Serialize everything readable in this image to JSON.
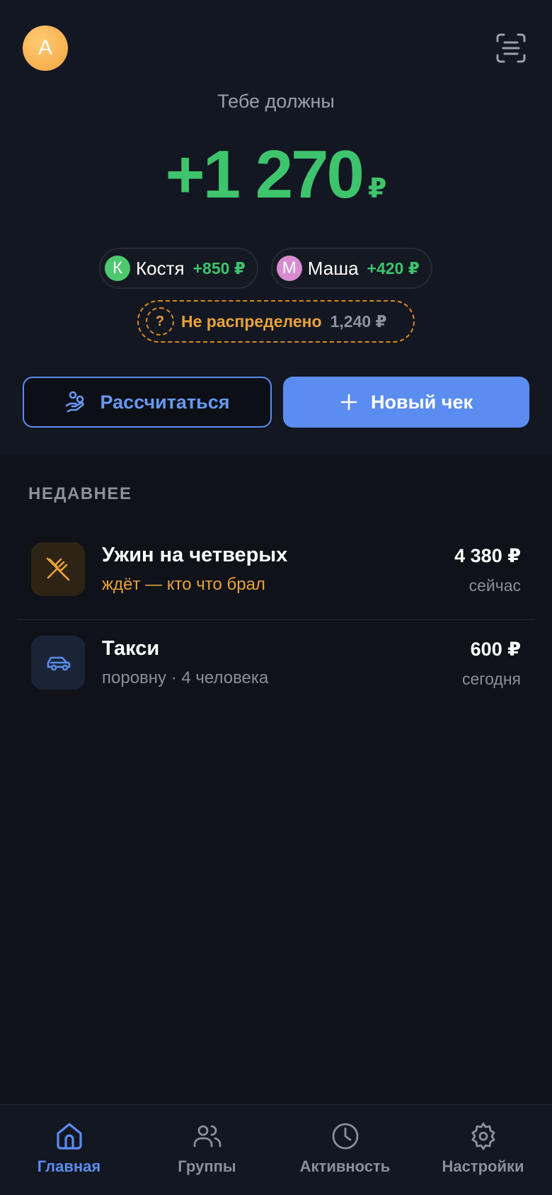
{
  "colors": {
    "accent": "#5b8cef",
    "positive": "#3ec46d",
    "warning": "#e9a23b",
    "muted": "#8a8f99"
  },
  "header": {
    "avatar_letter": "A",
    "scan_icon": "scan-receipt-icon"
  },
  "balance": {
    "label": "Тебе должны",
    "amount": "+1 270",
    "currency": "₽"
  },
  "debtors": [
    {
      "initial": "К",
      "name": "Костя",
      "amount": "+850 ₽",
      "color": "#4cc96e"
    },
    {
      "initial": "М",
      "name": "Маша",
      "amount": "+420 ₽",
      "color": "#d88bd0"
    }
  ],
  "unassigned": {
    "icon": "?",
    "label": "Не распределено",
    "amount": "1,240 ₽"
  },
  "actions": {
    "settle_label": "Рассчитаться",
    "settle_icon": "hand-coins-icon",
    "new_label": "Новый чек",
    "new_icon": "plus-icon"
  },
  "recent": {
    "title": "НЕДАВНЕЕ",
    "items": [
      {
        "title": "Ужин на четверых",
        "subtitle": "ждёт — кто что брал",
        "amount": "4 380 ₽",
        "time": "сейчас",
        "icon": "utensils-icon",
        "status": "pending"
      },
      {
        "title": "Такси",
        "subtitle": "поровну · 4 человека",
        "amount": "600 ₽",
        "time": "сегодня",
        "icon": "car-icon",
        "status": "split"
      }
    ]
  },
  "tabs": [
    {
      "label": "Главная",
      "icon": "home-icon",
      "active": true
    },
    {
      "label": "Группы",
      "icon": "users-icon",
      "active": false
    },
    {
      "label": "Активность",
      "icon": "clock-icon",
      "active": false
    },
    {
      "label": "Настройки",
      "icon": "gear-icon",
      "active": false
    }
  ]
}
